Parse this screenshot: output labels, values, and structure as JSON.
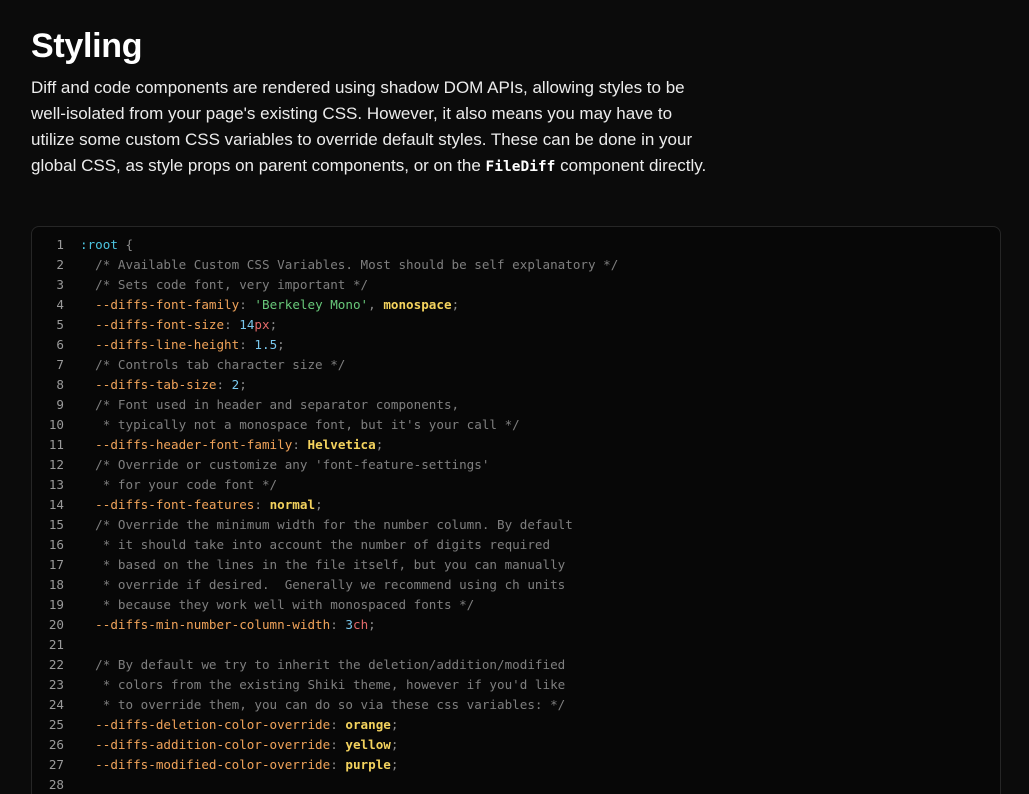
{
  "heading": "Styling",
  "intro": {
    "before": "Diff and code components are rendered using shadow DOM APIs, allowing styles to be well-isolated from your page's existing CSS. However, it also means you may have to utilize some custom CSS variables to override default styles. These can be done in your global CSS, as style props on parent components, or on the ",
    "code": "FileDiff",
    "after": " component directly."
  },
  "code_lines": [
    {
      "n": "1",
      "tokens": [
        {
          "t": ":root",
          "c": "sel"
        },
        {
          "t": " {",
          "c": "punc"
        }
      ]
    },
    {
      "n": "2",
      "tokens": [
        {
          "t": "  /* Available Custom CSS Variables. Most should be self explanatory */",
          "c": "com"
        }
      ]
    },
    {
      "n": "3",
      "tokens": [
        {
          "t": "  /* Sets code font, very important */",
          "c": "com"
        }
      ]
    },
    {
      "n": "4",
      "tokens": [
        {
          "t": "  --diffs-font-family",
          "c": "prop"
        },
        {
          "t": ": ",
          "c": "punc"
        },
        {
          "t": "'Berkeley Mono'",
          "c": "str"
        },
        {
          "t": ", ",
          "c": "punc"
        },
        {
          "t": "monospace",
          "c": "kw"
        },
        {
          "t": ";",
          "c": "punc"
        }
      ]
    },
    {
      "n": "5",
      "tokens": [
        {
          "t": "  --diffs-font-size",
          "c": "prop"
        },
        {
          "t": ": ",
          "c": "punc"
        },
        {
          "t": "14",
          "c": "num"
        },
        {
          "t": "px",
          "c": "unit"
        },
        {
          "t": ";",
          "c": "punc"
        }
      ]
    },
    {
      "n": "6",
      "tokens": [
        {
          "t": "  --diffs-line-height",
          "c": "prop"
        },
        {
          "t": ": ",
          "c": "punc"
        },
        {
          "t": "1.5",
          "c": "num"
        },
        {
          "t": ";",
          "c": "punc"
        }
      ]
    },
    {
      "n": "7",
      "tokens": [
        {
          "t": "  /* Controls tab character size */",
          "c": "com"
        }
      ]
    },
    {
      "n": "8",
      "tokens": [
        {
          "t": "  --diffs-tab-size",
          "c": "prop"
        },
        {
          "t": ": ",
          "c": "punc"
        },
        {
          "t": "2",
          "c": "num"
        },
        {
          "t": ";",
          "c": "punc"
        }
      ]
    },
    {
      "n": "9",
      "tokens": [
        {
          "t": "  /* Font used in header and separator components,",
          "c": "com"
        }
      ]
    },
    {
      "n": "10",
      "tokens": [
        {
          "t": "   * typically not a monospace font, but it's your call */",
          "c": "com"
        }
      ]
    },
    {
      "n": "11",
      "tokens": [
        {
          "t": "  --diffs-header-font-family",
          "c": "prop"
        },
        {
          "t": ": ",
          "c": "punc"
        },
        {
          "t": "Helvetica",
          "c": "kw"
        },
        {
          "t": ";",
          "c": "punc"
        }
      ]
    },
    {
      "n": "12",
      "tokens": [
        {
          "t": "  /* Override or customize any 'font-feature-settings'",
          "c": "com"
        }
      ]
    },
    {
      "n": "13",
      "tokens": [
        {
          "t": "   * for your code font */",
          "c": "com"
        }
      ]
    },
    {
      "n": "14",
      "tokens": [
        {
          "t": "  --diffs-font-features",
          "c": "prop"
        },
        {
          "t": ": ",
          "c": "punc"
        },
        {
          "t": "normal",
          "c": "kw"
        },
        {
          "t": ";",
          "c": "punc"
        }
      ]
    },
    {
      "n": "15",
      "tokens": [
        {
          "t": "  /* Override the minimum width for the number column. By default",
          "c": "com"
        }
      ]
    },
    {
      "n": "16",
      "tokens": [
        {
          "t": "   * it should take into account the number of digits required",
          "c": "com"
        }
      ]
    },
    {
      "n": "17",
      "tokens": [
        {
          "t": "   * based on the lines in the file itself, but you can manually",
          "c": "com"
        }
      ]
    },
    {
      "n": "18",
      "tokens": [
        {
          "t": "   * override if desired.  Generally we recommend using ch units",
          "c": "com"
        }
      ]
    },
    {
      "n": "19",
      "tokens": [
        {
          "t": "   * because they work well with monospaced fonts */",
          "c": "com"
        }
      ]
    },
    {
      "n": "20",
      "tokens": [
        {
          "t": "  --diffs-min-number-column-width",
          "c": "prop"
        },
        {
          "t": ": ",
          "c": "punc"
        },
        {
          "t": "3",
          "c": "num"
        },
        {
          "t": "ch",
          "c": "unit"
        },
        {
          "t": ";",
          "c": "punc"
        }
      ]
    },
    {
      "n": "21",
      "tokens": []
    },
    {
      "n": "22",
      "tokens": [
        {
          "t": "  /* By default we try to inherit the deletion/addition/modified",
          "c": "com"
        }
      ]
    },
    {
      "n": "23",
      "tokens": [
        {
          "t": "   * colors from the existing Shiki theme, however if you'd like",
          "c": "com"
        }
      ]
    },
    {
      "n": "24",
      "tokens": [
        {
          "t": "   * to override them, you can do so via these css variables: */",
          "c": "com"
        }
      ]
    },
    {
      "n": "25",
      "tokens": [
        {
          "t": "  --diffs-deletion-color-override",
          "c": "prop"
        },
        {
          "t": ": ",
          "c": "punc"
        },
        {
          "t": "orange",
          "c": "kw"
        },
        {
          "t": ";",
          "c": "punc"
        }
      ]
    },
    {
      "n": "26",
      "tokens": [
        {
          "t": "  --diffs-addition-color-override",
          "c": "prop"
        },
        {
          "t": ": ",
          "c": "punc"
        },
        {
          "t": "yellow",
          "c": "kw"
        },
        {
          "t": ";",
          "c": "punc"
        }
      ]
    },
    {
      "n": "27",
      "tokens": [
        {
          "t": "  --diffs-modified-color-override",
          "c": "prop"
        },
        {
          "t": ": ",
          "c": "punc"
        },
        {
          "t": "purple",
          "c": "kw"
        },
        {
          "t": ";",
          "c": "punc"
        }
      ]
    },
    {
      "n": "28",
      "tokens": []
    }
  ],
  "colors": {
    "background": "#0b0b0b",
    "code_background": "#070707",
    "selector": "#4cc4e0",
    "comment": "#7f7f7f",
    "property": "#f0a35a",
    "string": "#68c87a",
    "keyword": "#f4d35e",
    "number": "#79c7ec",
    "unit": "#e46a6a"
  }
}
